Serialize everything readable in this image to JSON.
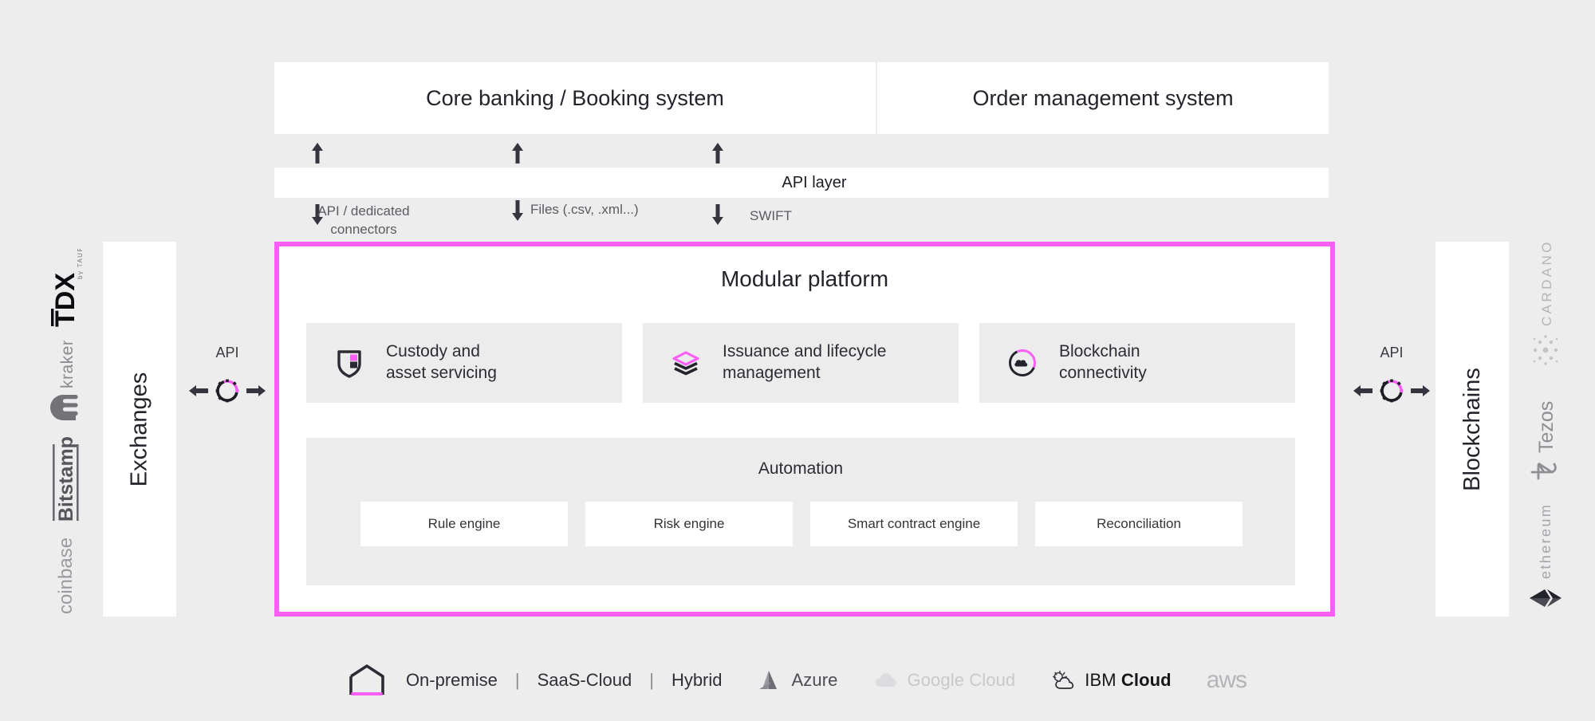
{
  "colors": {
    "accent_magenta": "#f95ff5",
    "background": "#ededed",
    "panel_gray": "#ececec",
    "text_dark": "#23232b",
    "text_muted": "#5b5b63"
  },
  "top_systems": [
    {
      "label": "Core banking / Booking system"
    },
    {
      "label": "Order management system"
    }
  ],
  "api_layer": {
    "label": "API layer"
  },
  "connectors": [
    {
      "label": "API / dedicated connectors",
      "line1": "API / dedicated",
      "line2": "connectors"
    },
    {
      "label": "Files  (.csv, .xml...)",
      "line1": "Files  (.csv, .xml...)",
      "line2": ""
    },
    {
      "label": "SWIFT",
      "line1": "SWIFT",
      "line2": ""
    }
  ],
  "platform": {
    "title": "Modular platform",
    "modules": [
      {
        "label_line1": "Custody and",
        "label_line2": "asset servicing",
        "icon": "shield-icon"
      },
      {
        "label_line1": "Issuance and lifecycle",
        "label_line2": "management",
        "icon": "layers-icon"
      },
      {
        "label_line1": "Blockchain",
        "label_line2": "connectivity",
        "icon": "cloud-ring-icon"
      }
    ],
    "automation": {
      "title": "Automation",
      "items": [
        {
          "label": "Rule engine"
        },
        {
          "label": "Risk engine"
        },
        {
          "label": "Smart contract engine"
        },
        {
          "label": "Reconciliation"
        }
      ]
    }
  },
  "left_side": {
    "panel_label": "Exchanges",
    "api_label": "API",
    "logos": [
      {
        "name": "TDX",
        "sub": "by TAURUS"
      },
      {
        "name": "kraken",
        "sub": ""
      },
      {
        "name": "Bitstamp",
        "sub": ""
      },
      {
        "name": "coinbase",
        "sub": ""
      }
    ]
  },
  "right_side": {
    "panel_label": "Blockchains",
    "api_label": "API",
    "logos": [
      {
        "name": "CARDANO",
        "sub": ""
      },
      {
        "name": "Tezos",
        "sub": ""
      },
      {
        "name": "ethereum",
        "sub": ""
      }
    ]
  },
  "deployment": {
    "options": [
      {
        "label": "On-premise"
      },
      {
        "label": "SaaS-Cloud"
      },
      {
        "label": "Hybrid"
      }
    ],
    "separator": "|",
    "providers": [
      {
        "label": "Azure",
        "icon": "azure-icon"
      },
      {
        "label": "Google Cloud",
        "icon": "google-cloud-icon"
      },
      {
        "label": "IBM Cloud",
        "label_plain": "IBM ",
        "label_bold": "Cloud",
        "icon": "ibm-cloud-icon"
      },
      {
        "label": "aws",
        "icon": "aws-icon"
      }
    ]
  }
}
